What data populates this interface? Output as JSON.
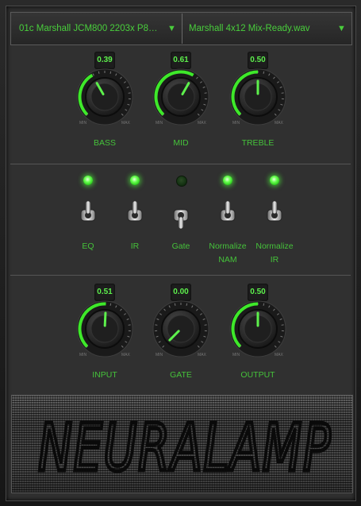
{
  "header": {
    "model_select": "01c Marshall JCM800 2203x P8B...",
    "ir_select": "Marshall 4x12 Mix-Ready.wav",
    "dropdown_arrow": "▼"
  },
  "tone_knobs": [
    {
      "id": "bass",
      "label": "BASS",
      "value_text": "0.39",
      "value": 0.39
    },
    {
      "id": "mid",
      "label": "MID",
      "value_text": "0.61",
      "value": 0.61
    },
    {
      "id": "treble",
      "label": "TREBLE",
      "value_text": "0.50",
      "value": 0.5
    }
  ],
  "switches": [
    {
      "id": "eq",
      "label_line1": "EQ",
      "label_line2": "",
      "on": true
    },
    {
      "id": "ir",
      "label_line1": "IR",
      "label_line2": "",
      "on": true
    },
    {
      "id": "gate",
      "label_line1": "Gate",
      "label_line2": "",
      "on": false
    },
    {
      "id": "normalize-nam",
      "label_line1": "Normalize",
      "label_line2": "NAM",
      "on": true
    },
    {
      "id": "normalize-ir",
      "label_line1": "Normalize",
      "label_line2": "IR",
      "on": true
    }
  ],
  "level_knobs": [
    {
      "id": "input",
      "label": "INPUT",
      "value_text": "0.51",
      "value": 0.51
    },
    {
      "id": "gate",
      "label": "GATE",
      "value_text": "0.00",
      "value": 0.0
    },
    {
      "id": "output",
      "label": "OUTPUT",
      "value_text": "0.50",
      "value": 0.5
    }
  ],
  "knob_scale": {
    "min": "MIN",
    "max": "MAX"
  },
  "logo_text": "NEURALAMP",
  "colors": {
    "accent": "#49ce3c",
    "led_on": "#6bff52",
    "panel": "#303030"
  }
}
